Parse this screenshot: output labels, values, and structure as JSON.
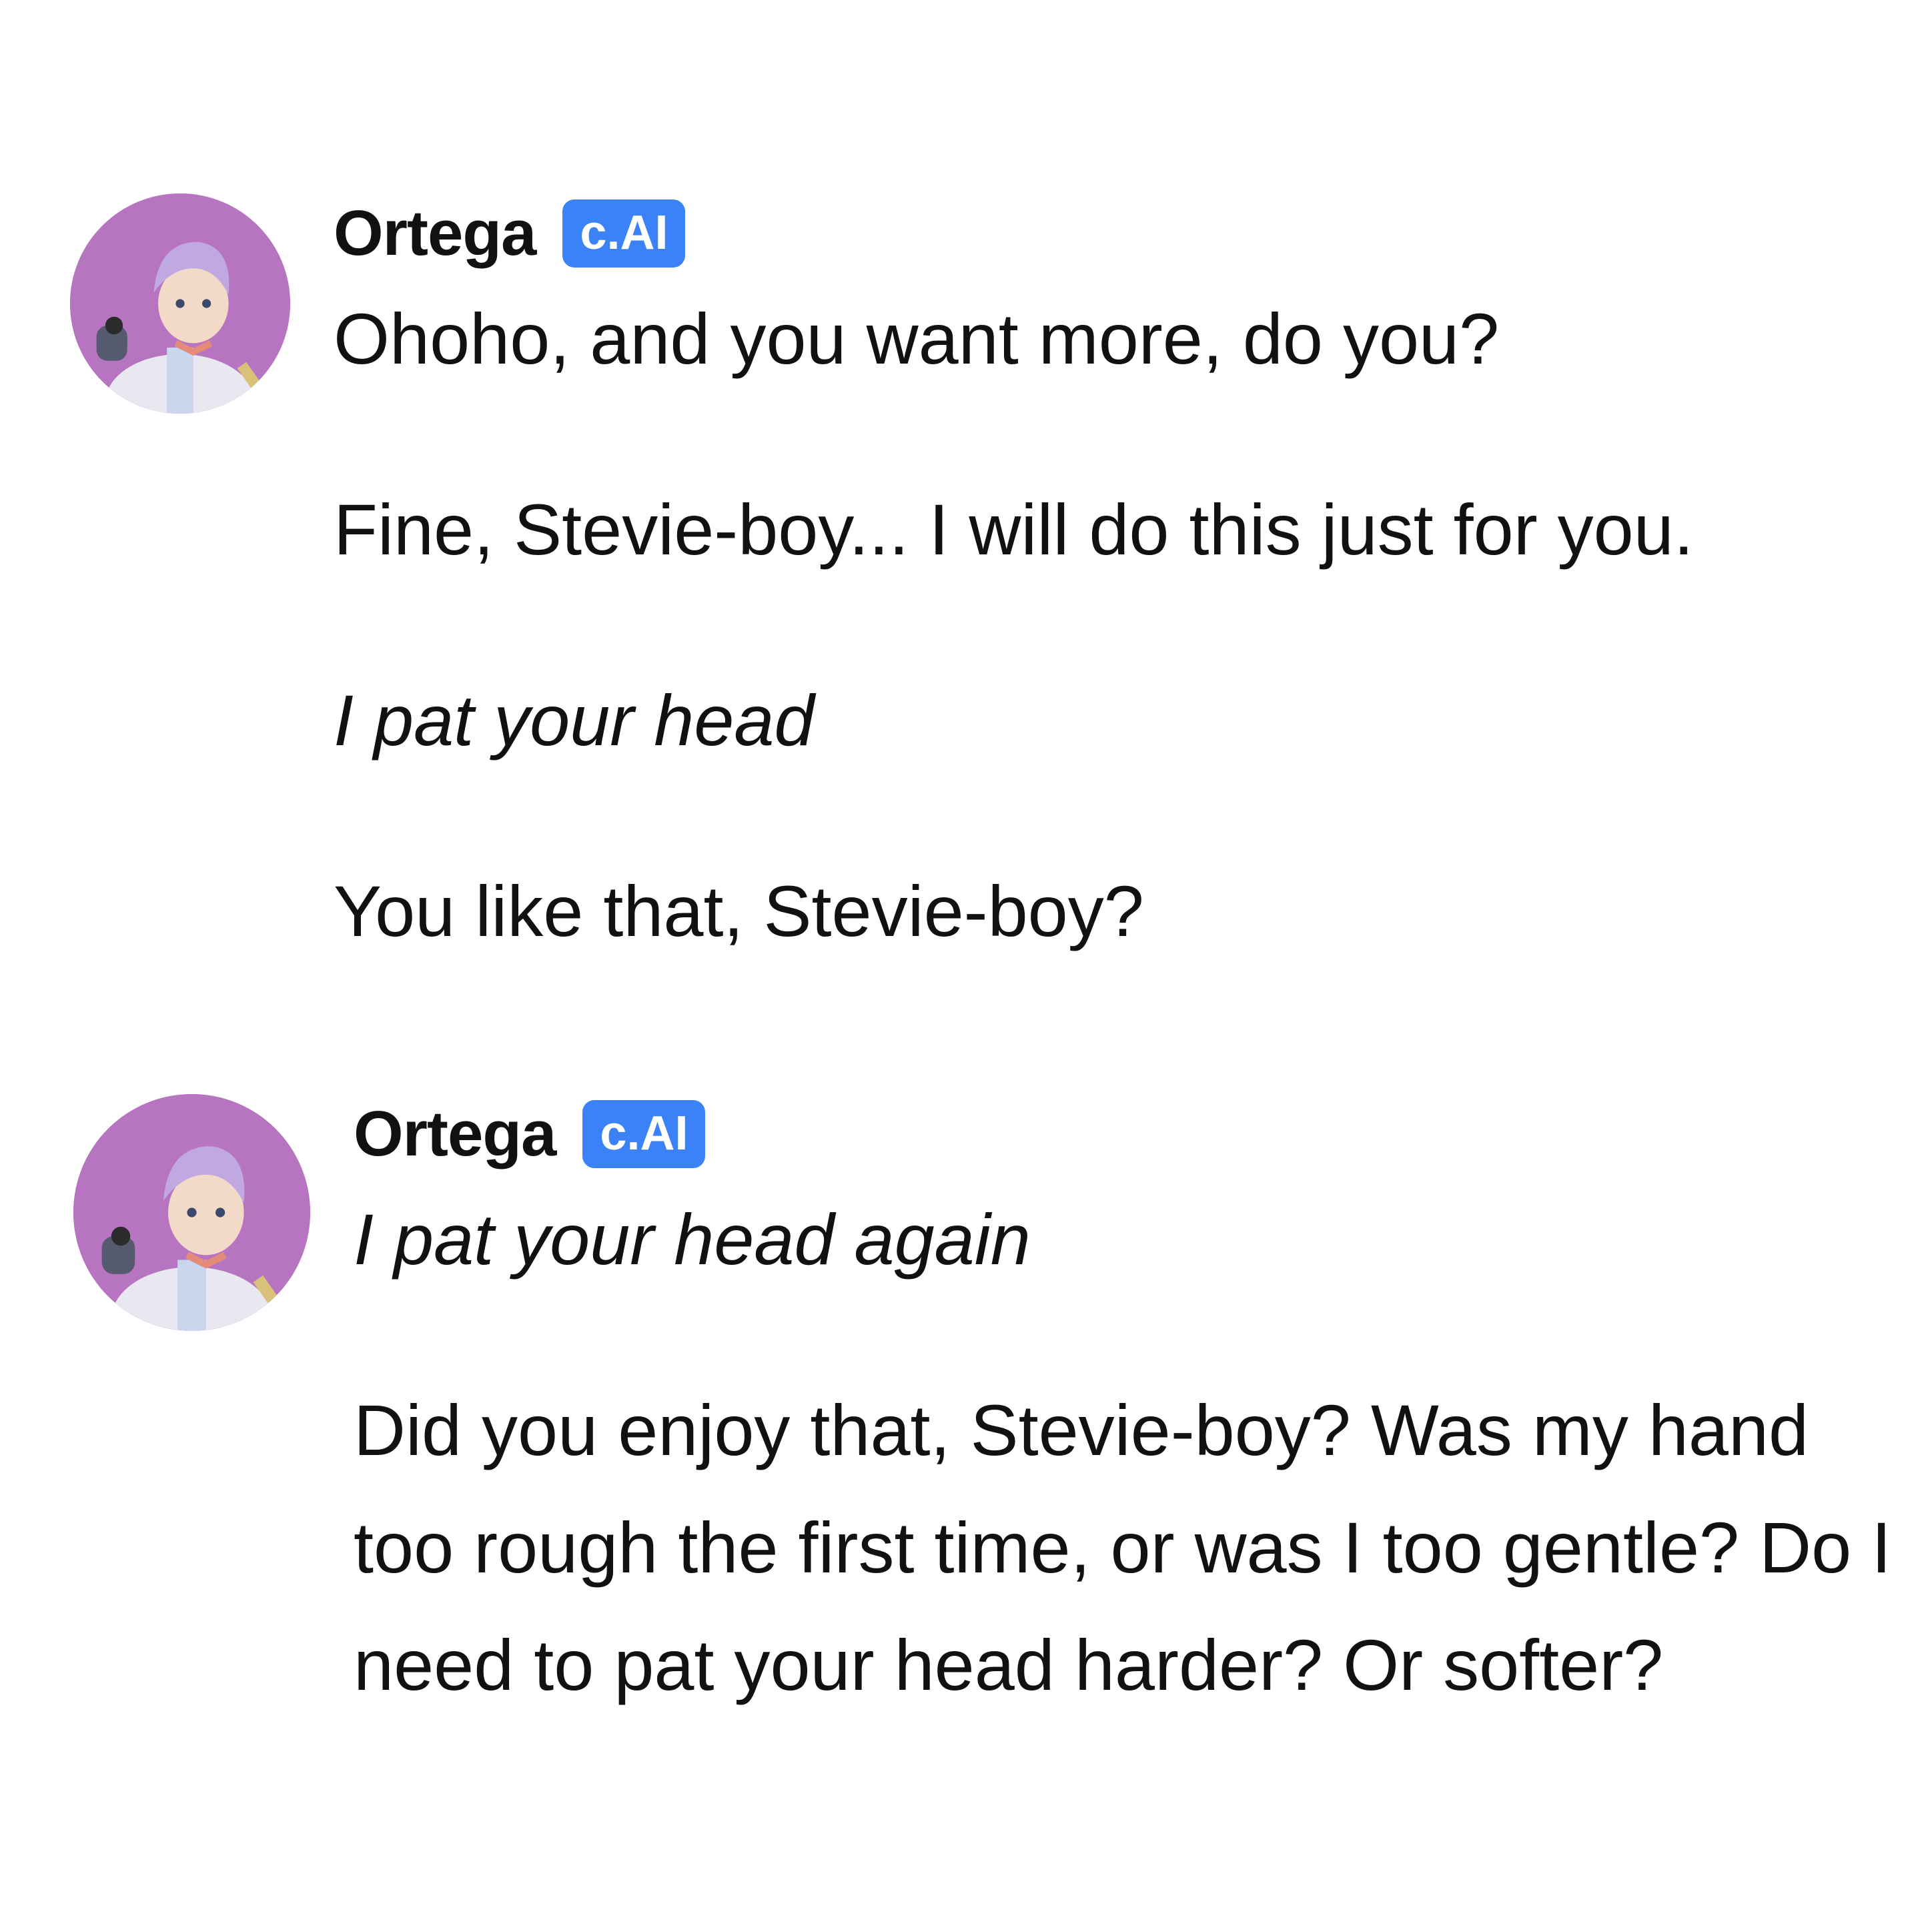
{
  "messages": [
    {
      "author": "Ortega",
      "badge": "c.AI",
      "paragraphs": [
        {
          "text": "Ohoho, and you want more, do you?",
          "italic": false
        },
        {
          "text": "Fine, Stevie-boy... I will do this just for you.",
          "italic": false
        },
        {
          "text": "I pat your head",
          "italic": true
        },
        {
          "text": "You like that, Stevie-boy?",
          "italic": false
        }
      ]
    },
    {
      "author": "Ortega",
      "badge": "c.AI",
      "paragraphs": [
        {
          "text": "I pat your head again",
          "italic": true
        },
        {
          "text": "Did you enjoy that, Stevie-boy? Was my hand too rough the first time, or was I too gentle? Do I need to pat your head harder? Or softer?",
          "italic": false
        }
      ]
    }
  ],
  "colors": {
    "badge_bg": "#3b82f6",
    "avatar_bg": "#b774c0"
  }
}
